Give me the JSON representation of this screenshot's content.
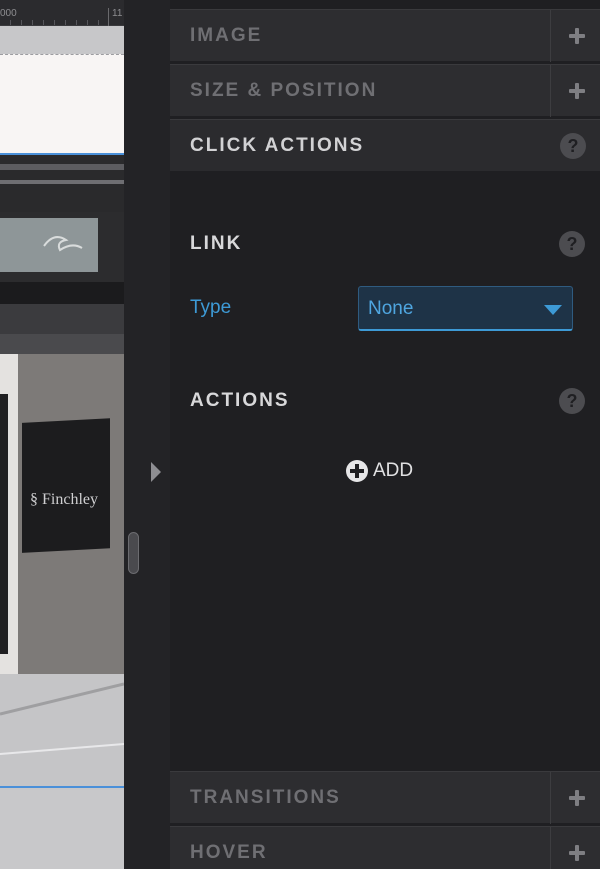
{
  "ruler": {
    "label_left": "000",
    "label_right": "11"
  },
  "panel": {
    "sections_top": [
      {
        "name": "image",
        "title": "IMAGE"
      },
      {
        "name": "size-position",
        "title": "SIZE & POSITION"
      }
    ],
    "active_section": {
      "title": "CLICK ACTIONS",
      "help": "?",
      "link": {
        "title": "LINK",
        "help": "?",
        "type_label": "Type",
        "type_value": "None"
      },
      "actions": {
        "title": "ACTIONS",
        "help": "?",
        "add_label": "ADD"
      }
    },
    "sections_bottom": [
      {
        "name": "transitions",
        "title": "TRANSITIONS"
      },
      {
        "name": "hover",
        "title": "HOVER"
      }
    ]
  },
  "colors": {
    "panel_bg": "#1f1f22",
    "header_bg": "#2d2d30",
    "accent_blue": "#3d9ad6",
    "muted_text": "#6f6f73",
    "active_text": "#d2d2d4"
  },
  "icons": {
    "plus": "plus-icon",
    "help": "help-icon",
    "dropdown": "chevron-down-icon",
    "add": "plus-circle-icon",
    "collapse": "chevron-right-icon"
  }
}
